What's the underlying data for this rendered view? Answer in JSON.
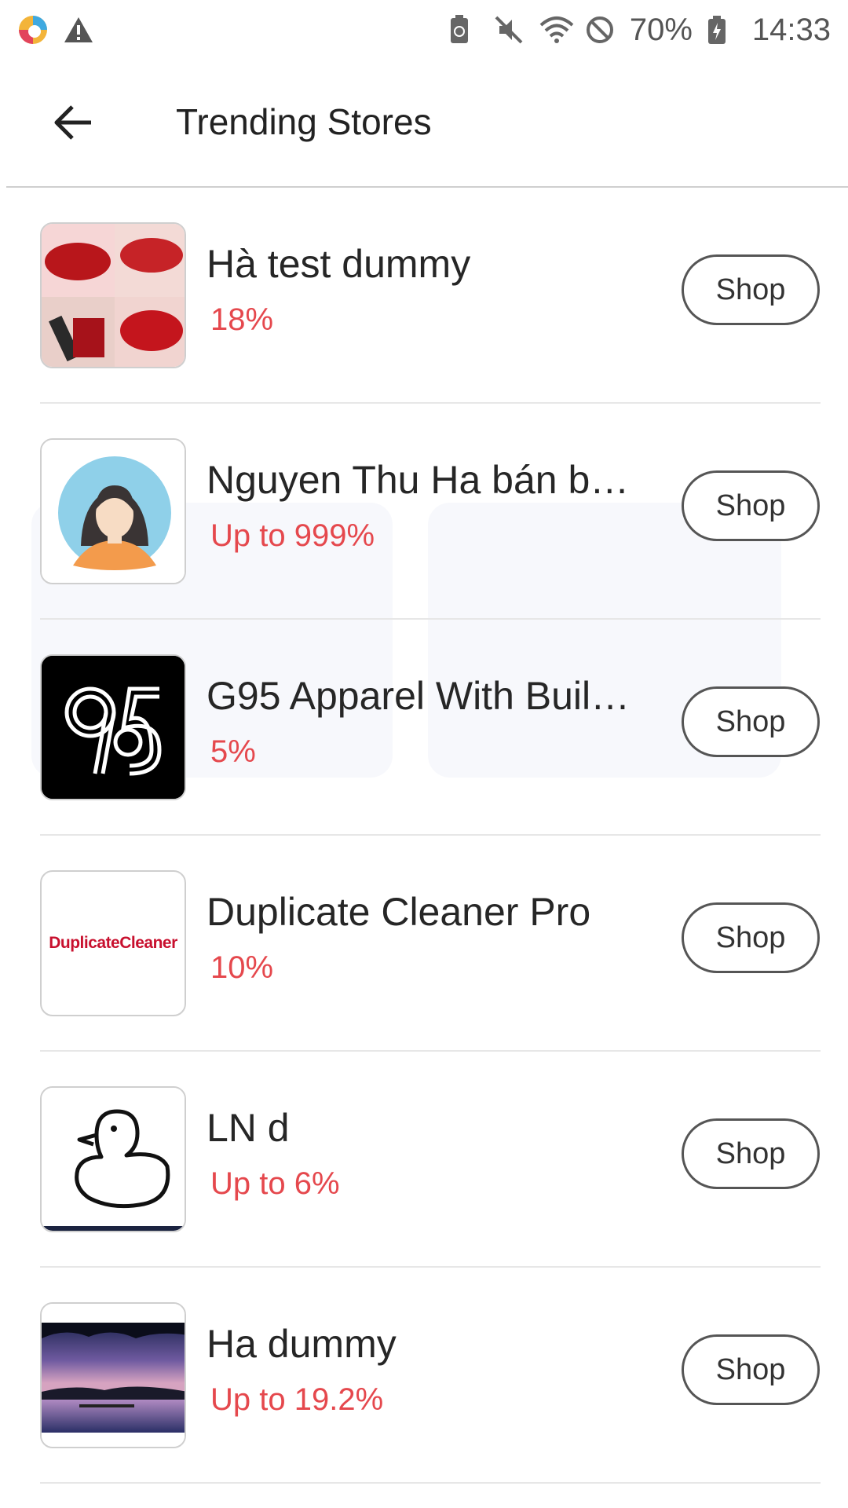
{
  "status_bar": {
    "battery_percent": "70%",
    "time": "14:33"
  },
  "header": {
    "title": "Trending Stores"
  },
  "stores": [
    {
      "name": "Hà test dummy",
      "cashback": "18%",
      "shop_label": "Shop",
      "icon": "lips-photo-icon"
    },
    {
      "name": "Nguyen Thu Ha bán b…",
      "cashback": "Up to 999%",
      "shop_label": "Shop",
      "icon": "avatar-woman-icon"
    },
    {
      "name": "G95 Apparel With Buil…",
      "cashback": "5%",
      "shop_label": "Shop",
      "icon": "g95-logo-icon"
    },
    {
      "name": "Duplicate Cleaner Pro",
      "cashback": "10%",
      "shop_label": "Shop",
      "icon": "duplicate-cleaner-logo"
    },
    {
      "name": "LN d",
      "cashback": "Up to 6%",
      "shop_label": "Shop",
      "icon": "duck-icon"
    },
    {
      "name": "Ha dummy",
      "cashback": "Up to 19.2%",
      "shop_label": "Shop",
      "icon": "lake-sunset-photo-icon"
    }
  ],
  "logos": {
    "duplicate_cleaner_text": "DuplicateCleaner"
  },
  "colors": {
    "accent_red": "#e5484d",
    "divider": "#e7e7e7",
    "button_border": "#555555"
  }
}
